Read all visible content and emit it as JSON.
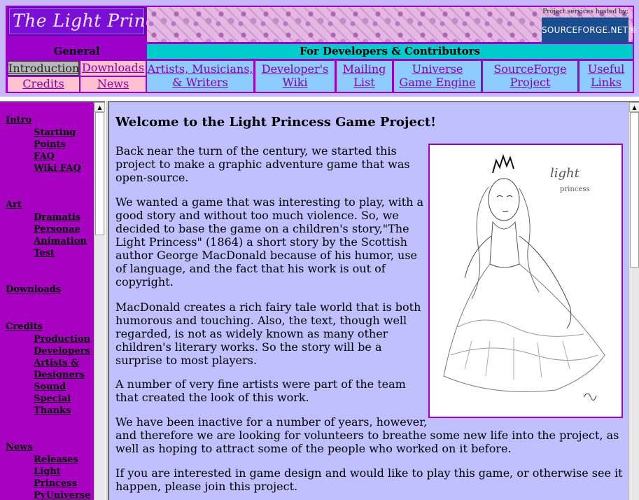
{
  "header": {
    "logo_text": "The Light Princess",
    "sf_caption": "Project services hosted by:",
    "sf_logo": "SOURCEFORGE.NET®",
    "general_heading": "General",
    "developers_heading": "For Developers & Contributors",
    "general_links": [
      "Introduction",
      "Downloads",
      "Credits",
      "News"
    ],
    "developer_links": [
      {
        "line1": "Artists, Musicians,",
        "line2": "& Writers"
      },
      {
        "line1": "Developer's",
        "line2": "Wiki"
      },
      {
        "line1": "Mailing",
        "line2": "List"
      },
      {
        "line1": "Universe",
        "line2": "Game Engine"
      },
      {
        "line1": "SourceForge",
        "line2": "Project"
      },
      {
        "line1": "Useful",
        "line2": "Links"
      }
    ]
  },
  "sidebar": {
    "groups": [
      {
        "label": "Intro",
        "items": [
          "Starting",
          "Points",
          "FAQ",
          "Wiki FAQ"
        ]
      },
      {
        "label": "Art",
        "items": [
          "Dramatis",
          "Personae",
          "Animation",
          "Test"
        ]
      },
      {
        "label": "Downloads",
        "items": []
      },
      {
        "label": "Credits",
        "items": [
          "Production",
          "Developers",
          "Artists &",
          "Designers",
          "Sound",
          "Special",
          "Thanks"
        ]
      },
      {
        "label": "News",
        "items": [
          "Releases",
          "Light",
          "Princess",
          "PyUniverse"
        ]
      }
    ]
  },
  "main": {
    "title": "Welcome to the Light Princess Game Project!",
    "paragraphs": [
      "Back near the turn of the century, we started this project to make a graphic adventure game that was open-source.",
      "We wanted a game that was interesting to play, with a good story and without too much violence. So, we decided to base the game on a children's story,\"The Light Princess\" (1864) a short story by the Scottish author George MacDonald because of his humor, use of language, and the fact that his work is out of copyright.",
      "MacDonald creates a rich fairy tale world that is both humorous and touching. Also, the text, though well regarded, is not as widely known as many other children's literary works. So the story will be a surprise to most players.",
      "A number of very fine artists were part of the team that created the look of this work.",
      "We have been inactive for a number of years, however,",
      "and therefore we are looking for volunteers to breathe some new life into the project, as well as hoping to attract some of the people who worked on it before.",
      "If you are interested in game design and would like to play this game, or otherwise see it happen, please join this project."
    ],
    "image_caption_1": "light",
    "image_caption_2": "princess"
  },
  "colors": {
    "purple": "#9a00c8",
    "cyan": "#00cccc",
    "pink": "#ffc0d0",
    "lightblue": "#8ecbff",
    "lavender": "#c0c0ff"
  }
}
